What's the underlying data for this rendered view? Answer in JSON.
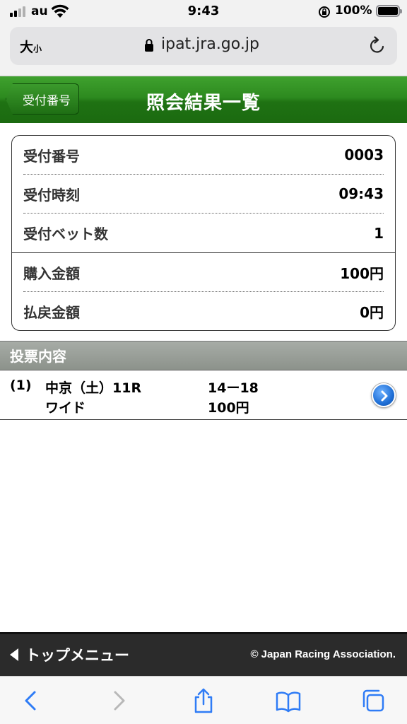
{
  "status_bar": {
    "carrier": "au",
    "time": "9:43",
    "battery": "100%"
  },
  "url_bar": {
    "text_size_large": "大",
    "text_size_small": "小",
    "url": "ipat.jra.go.jp"
  },
  "header": {
    "back_label": "受付番号",
    "title": "照会結果一覧"
  },
  "receipt": {
    "rows": [
      {
        "label": "受付番号",
        "value": "0003"
      },
      {
        "label": "受付時刻",
        "value": "09:43"
      },
      {
        "label": "受付ベット数",
        "value": "1"
      },
      {
        "label": "購入金額",
        "value": "100円"
      },
      {
        "label": "払戻金額",
        "value": "0円"
      }
    ]
  },
  "bets": {
    "section_title": "投票内容",
    "items": [
      {
        "index": "(1)",
        "race": "中京（土）11R",
        "type": "ワイド",
        "combination": "14ー18",
        "amount": "100円"
      }
    ]
  },
  "footer": {
    "top_menu_label": "トップメニュー",
    "copyright": "© Japan Racing Association."
  },
  "colors": {
    "header_green": "#1f7213",
    "section_gray": "#8c928b",
    "ios_blue": "#2f7cf6"
  }
}
